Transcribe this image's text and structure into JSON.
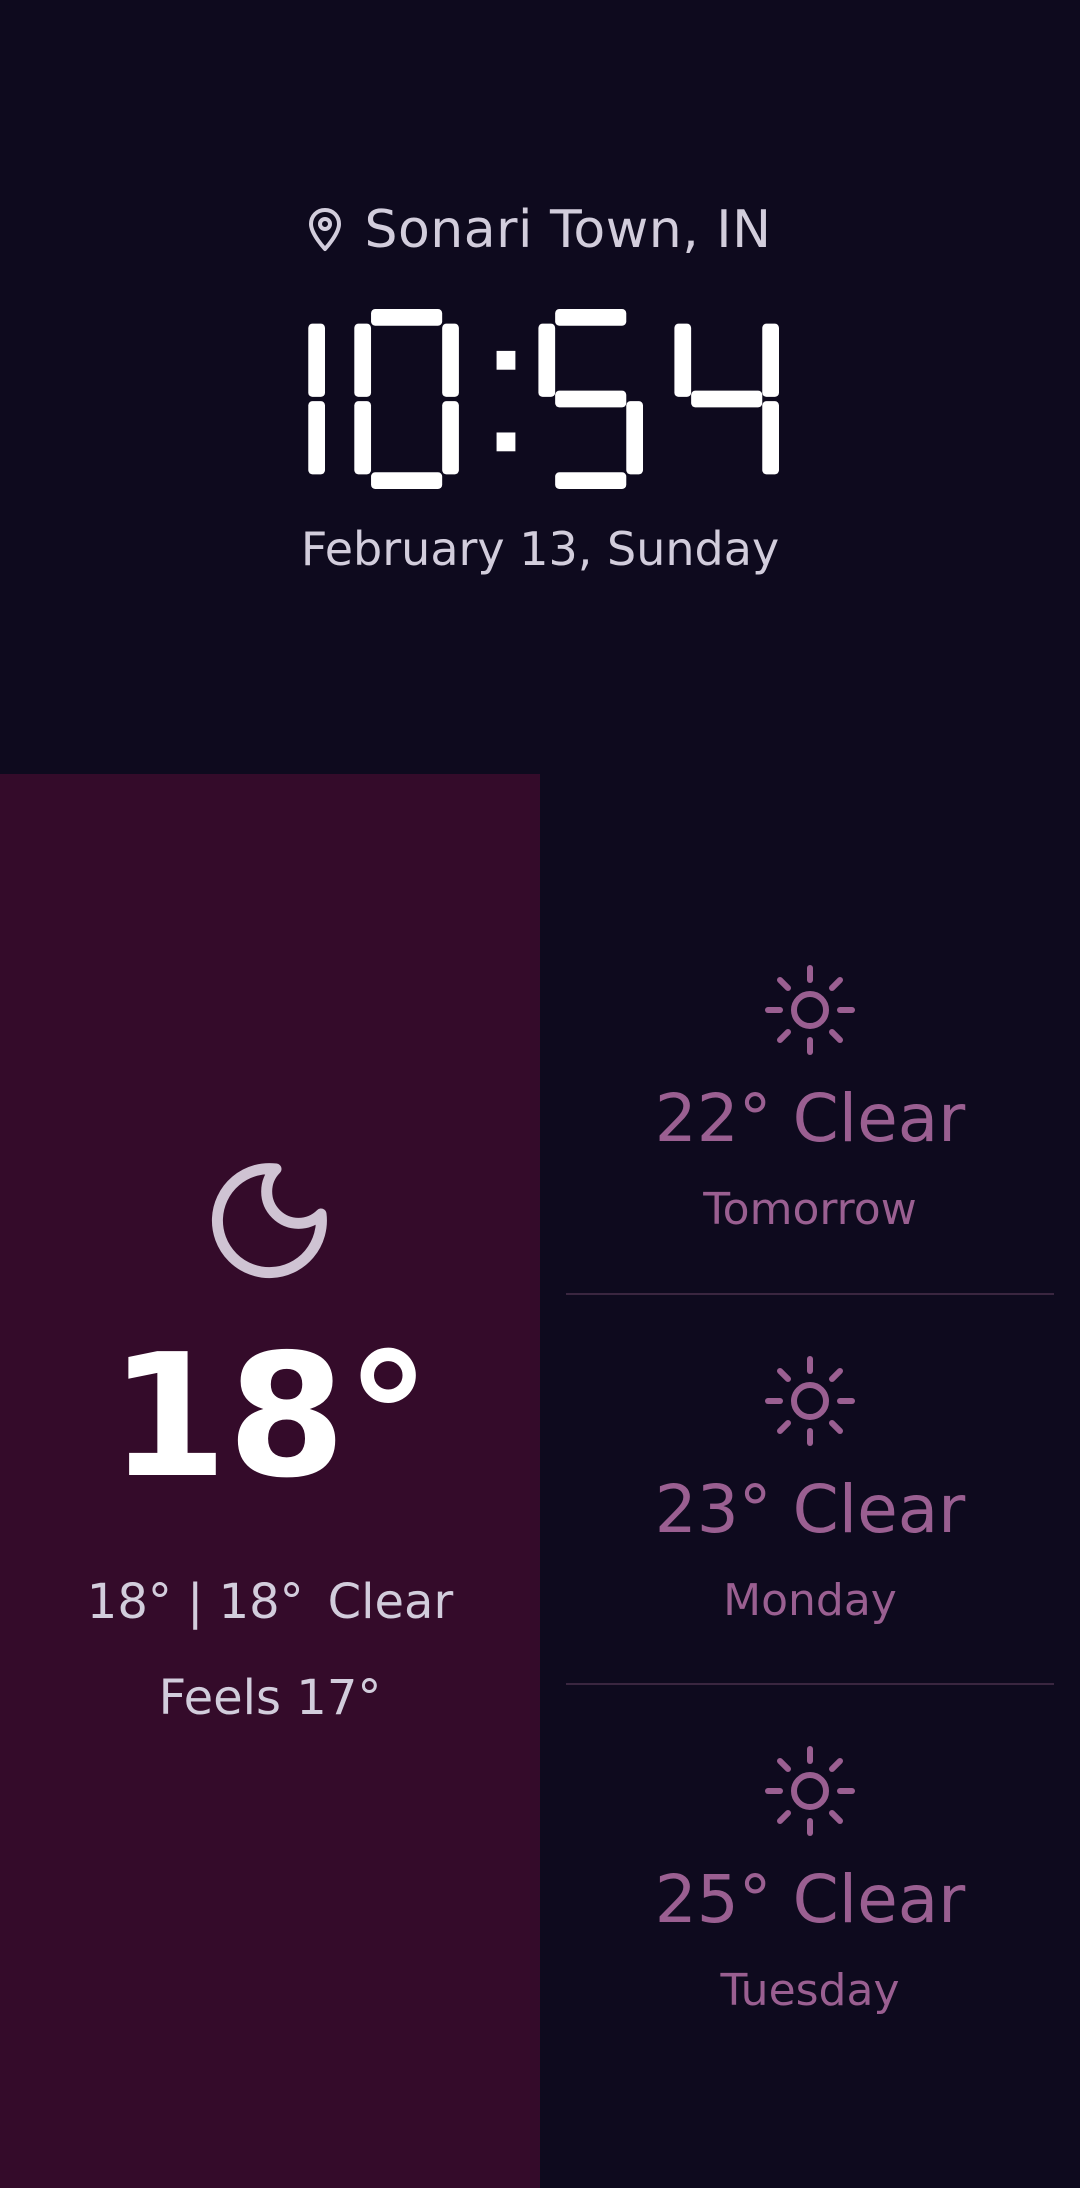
{
  "header": {
    "location": "Sonari Town, IN",
    "time": "10:54",
    "date": "February 13, Sunday"
  },
  "current": {
    "temperature": "18°",
    "high": "18°",
    "low": "18°",
    "separator": "|",
    "condition": "Clear",
    "feels": "Feels 17°",
    "icon": "moon-icon"
  },
  "forecast": [
    {
      "summary": "22° Clear",
      "day": "Tomorrow",
      "icon": "sun-icon"
    },
    {
      "summary": "23° Clear",
      "day": "Monday",
      "icon": "sun-icon"
    },
    {
      "summary": "25° Clear",
      "day": "Tuesday",
      "icon": "sun-icon"
    }
  ],
  "colors": {
    "background": "#0e0a1e",
    "current_panel": "#340b2a",
    "primary_text": "#d2cddc",
    "accent": "#9a5f91",
    "clock": "#ffffff"
  }
}
